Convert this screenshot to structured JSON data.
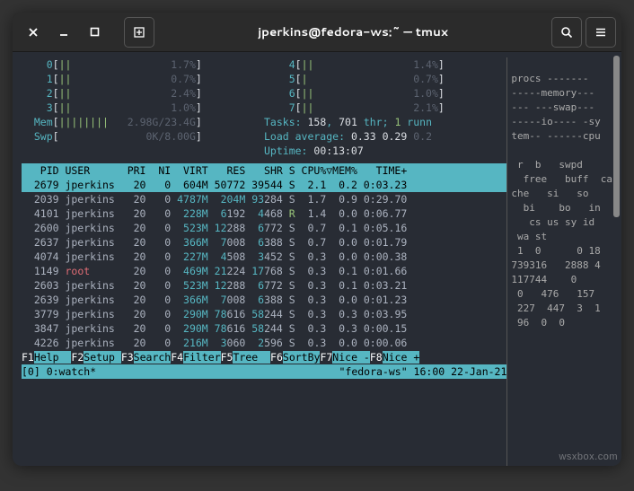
{
  "titlebar": {
    "title": "jperkins@fedora-ws:~ — tmux"
  },
  "cpu_meters_left": [
    {
      "idx": "0",
      "bars": "||",
      "pct": "1.7%"
    },
    {
      "idx": "1",
      "bars": "||",
      "pct": "0.7%"
    },
    {
      "idx": "2",
      "bars": "||",
      "pct": "2.4%"
    },
    {
      "idx": "3",
      "bars": "||",
      "pct": "1.0%"
    }
  ],
  "cpu_meters_right": [
    {
      "idx": "4",
      "bars": "||",
      "pct": "1.4%"
    },
    {
      "idx": "5",
      "bars": "|",
      "pct": "0.7%"
    },
    {
      "idx": "6",
      "bars": "||",
      "pct": "1.0%"
    },
    {
      "idx": "7",
      "bars": "||",
      "pct": "2.1%"
    }
  ],
  "mem": {
    "label": "Mem",
    "bars": "||||||||",
    "val": "2.98G/23.4G"
  },
  "swp": {
    "label": "Swp",
    "bars": "",
    "val": "0K/8.00G"
  },
  "tasks": {
    "prefix": "Tasks: ",
    "procs": "158",
    "sep1": ", ",
    "thr": "701",
    "thr_lbl": " thr; ",
    "run": "1",
    "run_lbl": " runn"
  },
  "loadavg": {
    "prefix": "Load average: ",
    "a": "0.33",
    "b": "0.29",
    "c": "0.2"
  },
  "uptime": {
    "prefix": "Uptime: ",
    "val": "00:13:07"
  },
  "columns": "   PID USER      PRI  NI  VIRT   RES   SHR S CPU%▽MEM%   TIME+",
  "procs": [
    {
      "pid": " 2679",
      "user": "jperkins",
      "pri": "20",
      "ni": "0",
      "virt": "604M",
      "res": "50772",
      "res_hi": "",
      "shr": "39544",
      "shr_hi": "",
      "s": "S",
      "cpu": "2.1",
      "mem": "0.2",
      "time": "0:03.23",
      "hi": true
    },
    {
      "pid": " 2039",
      "user": "jperkins",
      "pri": "20",
      "ni": "0",
      "virt": "4787M",
      "res": "204M",
      "res_hi": "",
      "shr": "93",
      "shr_hi": "284",
      "s": "S",
      "cpu": "1.7",
      "mem": "0.9",
      "time": "0:29.70"
    },
    {
      "pid": " 4101",
      "user": "jperkins",
      "pri": "20",
      "ni": "0",
      "virt": "228M",
      "res": "6",
      "res_hi": "192",
      "shr": "4",
      "shr_hi": "468",
      "s": "R",
      "cpu": "1.4",
      "mem": "0.0",
      "time": "0:06.77"
    },
    {
      "pid": " 2600",
      "user": "jperkins",
      "pri": "20",
      "ni": "0",
      "virt": "523M",
      "res": "12",
      "res_hi": "288",
      "shr": "6",
      "shr_hi": "772",
      "s": "S",
      "cpu": "0.7",
      "mem": "0.1",
      "time": "0:05.16"
    },
    {
      "pid": " 2637",
      "user": "jperkins",
      "pri": "20",
      "ni": "0",
      "virt": "366M",
      "res": "7",
      "res_hi": "008",
      "shr": "6",
      "shr_hi": "388",
      "s": "S",
      "cpu": "0.7",
      "mem": "0.0",
      "time": "0:01.79"
    },
    {
      "pid": " 4074",
      "user": "jperkins",
      "pri": "20",
      "ni": "0",
      "virt": "227M",
      "res": "4",
      "res_hi": "508",
      "shr": "3",
      "shr_hi": "452",
      "s": "S",
      "cpu": "0.3",
      "mem": "0.0",
      "time": "0:00.38"
    },
    {
      "pid": " 1149",
      "user_root": "root",
      "pri": "20",
      "ni": "0",
      "virt": "469M",
      "res": "21",
      "res_hi": "224",
      "shr": "17",
      "shr_hi": "768",
      "s": "S",
      "cpu": "0.3",
      "mem": "0.1",
      "time": "0:01.66"
    },
    {
      "pid": " 2603",
      "user": "jperkins",
      "pri": "20",
      "ni": "0",
      "virt": "523M",
      "res": "12",
      "res_hi": "288",
      "shr": "6",
      "shr_hi": "772",
      "s": "S",
      "cpu": "0.3",
      "mem": "0.1",
      "time": "0:03.21"
    },
    {
      "pid": " 2639",
      "user": "jperkins",
      "pri": "20",
      "ni": "0",
      "virt": "366M",
      "res": "7",
      "res_hi": "008",
      "shr": "6",
      "shr_hi": "388",
      "s": "S",
      "cpu": "0.3",
      "mem": "0.0",
      "time": "0:01.23"
    },
    {
      "pid": " 3779",
      "user": "jperkins",
      "pri": "20",
      "ni": "0",
      "virt": "290M",
      "res": "78",
      "res_hi": "616",
      "shr": "58",
      "shr_hi": "244",
      "s": "S",
      "cpu": "0.3",
      "mem": "0.3",
      "time": "0:03.95"
    },
    {
      "pid": " 3847",
      "user": "jperkins",
      "pri": "20",
      "ni": "0",
      "virt": "290M",
      "res": "78",
      "res_hi": "616",
      "shr": "58",
      "shr_hi": "244",
      "s": "S",
      "cpu": "0.3",
      "mem": "0.3",
      "time": "0:00.15"
    },
    {
      "pid": " 4226",
      "user": "jperkins",
      "pri": "20",
      "ni": "0",
      "virt": "216M",
      "res": "3",
      "res_hi": "060",
      "shr": "2",
      "shr_hi": "596",
      "s": "S",
      "cpu": "0.3",
      "mem": "0.0",
      "time": "0:00.06"
    }
  ],
  "fkeys": [
    {
      "k": "F1",
      "a": "Help  "
    },
    {
      "k": "F2",
      "a": "Setup "
    },
    {
      "k": "F3",
      "a": "Search"
    },
    {
      "k": "F4",
      "a": "Filter"
    },
    {
      "k": "F5",
      "a": "Tree  "
    },
    {
      "k": "F6",
      "a": "SortBy"
    },
    {
      "k": "F7",
      "a": "Nice -"
    },
    {
      "k": "F8",
      "a": "Nice +"
    }
  ],
  "tmux": {
    "left": "[0] 0:watch*",
    "right": "\"fedora-ws\" 16:00 22-Jan-21"
  },
  "right_pane_lines": [
    "",
    "procs ------- ",
    "-----memory---",
    "--- ---swap---",
    "-----io---- -sy",
    "tem-- ------cpu",
    "",
    " r  b   swpd  ",
    "  free   buff  ca",
    "che   si   so  ",
    "  bi    bo   in",
    "   cs us sy id",
    " wa st",
    " 1  0      0 18",
    "739316   2888 4",
    "117744    0   ",
    " 0   476   157 ",
    " 227  447  3  1",
    " 96  0  0"
  ],
  "watermark": "wsxbox.com"
}
